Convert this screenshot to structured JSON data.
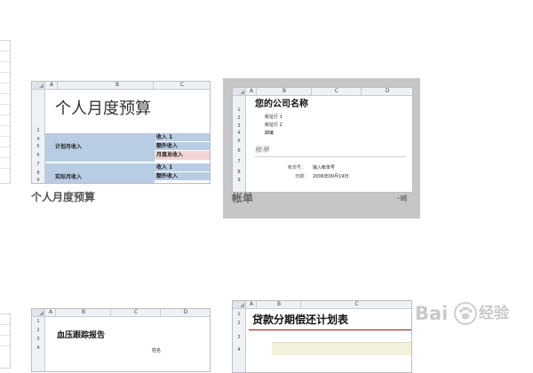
{
  "templates": [
    {
      "label": "个人月度预算",
      "sheet": {
        "columns": [
          "A",
          "B",
          "C"
        ],
        "rows": [
          "1",
          "2",
          "3",
          "4",
          "5",
          "6",
          "7",
          "8",
          "9"
        ],
        "title": "个人月度预算",
        "section1": "计划月收入",
        "section2": "实际月收入",
        "items1": [
          "收入 1",
          "额外收入",
          "月度总收入"
        ],
        "items2": [
          "收入 1",
          "额外收入"
        ]
      }
    },
    {
      "label": "帐单",
      "selected": true,
      "pin_icon": "pin-icon",
      "sheet": {
        "columns": [
          "A",
          "B",
          "C",
          "D"
        ],
        "rows": [
          "1",
          "2",
          "3",
          "4",
          "5",
          "6",
          "7",
          "8",
          "9"
        ],
        "company": "您的公司名称",
        "address1": "街址行 1",
        "address2": "街址行 2",
        "city": "邮编",
        "doc_title": "帐单",
        "account_label": "帐单号：",
        "account_value": "输入帐单号",
        "date_label": "日期：",
        "date_value": "2006年09月19日"
      }
    },
    {
      "label": "",
      "sheet": {
        "columns": [
          "A",
          "B",
          "C",
          "D"
        ],
        "rows": [
          "1",
          "2",
          "3",
          "4"
        ],
        "title": "血压跟踪报告",
        "name_label": "姓名"
      }
    },
    {
      "label": "",
      "sheet": {
        "columns": [
          "A",
          "B",
          "C"
        ],
        "rows": [
          "1",
          "2",
          "3",
          "4"
        ],
        "title": "贷款分期偿还计划表"
      }
    }
  ],
  "watermark": {
    "brand": "Bai",
    "paw_icon": "paw-icon",
    "suffix": "经验"
  }
}
